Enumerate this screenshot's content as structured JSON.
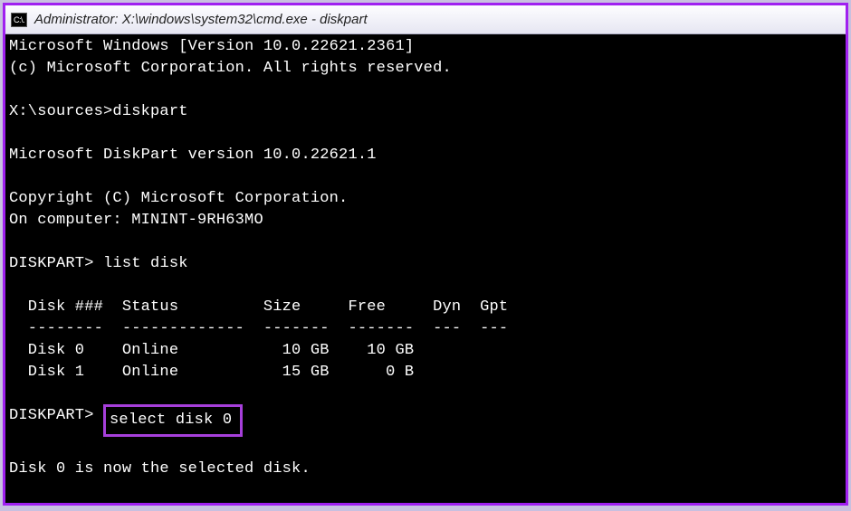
{
  "titlebar": {
    "icon_label": "C:\\.",
    "title": "Administrator: X:\\windows\\system32\\cmd.exe - diskpart"
  },
  "terminal": {
    "banner1": "Microsoft Windows [Version 10.0.22621.2361]",
    "banner2": "(c) Microsoft Corporation. All rights reserved.",
    "prompt1_prefix": "X:\\sources>",
    "prompt1_cmd": "diskpart",
    "dp_version": "Microsoft DiskPart version 10.0.22621.1",
    "dp_copyright": "Copyright (C) Microsoft Corporation.",
    "dp_computer": "On computer: MININT-9RH63MO",
    "dp_prompt": "DISKPART>",
    "cmd_listdisk": "list disk",
    "table_header": "  Disk ###  Status         Size     Free     Dyn  Gpt",
    "table_divider": "  --------  -------------  -------  -------  ---  ---",
    "table_row0": "  Disk 0    Online           10 GB    10 GB",
    "table_row1": "  Disk 1    Online           15 GB      0 B",
    "cmd_select": "select disk 0",
    "result": "Disk 0 is now the selected disk."
  }
}
